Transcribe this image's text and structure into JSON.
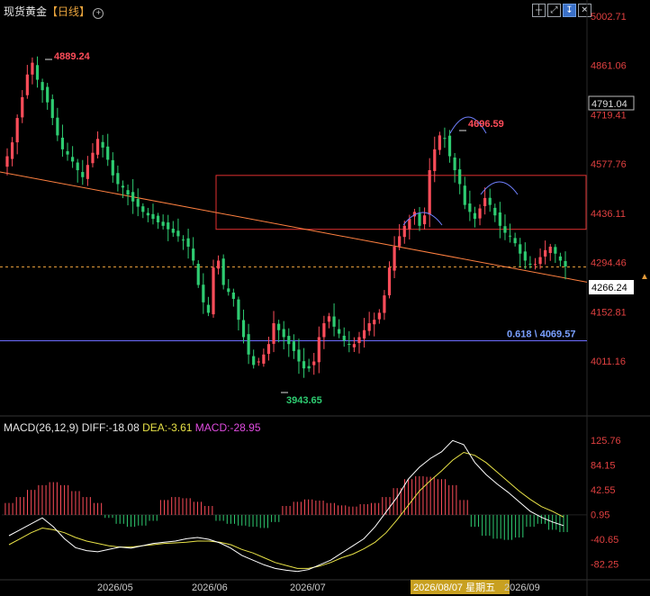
{
  "header": {
    "title": "现货黄金",
    "period": "【日线】",
    "toolbar_icons": [
      "crosshair-icon",
      "fullscreen-icon",
      "settings-icon",
      "close-icon"
    ]
  },
  "macd_header": {
    "label": "MACD(26,12,9)",
    "diff": "DIFF:-18.08",
    "dea": "DEA:-3.61",
    "macd": "MACD:-28.95"
  },
  "colors": {
    "up": "#ff4d5a",
    "down": "#2ecc71",
    "diff_line": "#ffffff",
    "dea_line": "#e8e247",
    "trendline": "#ff8040",
    "fib_line": "#6c6cff",
    "box": "#e03030",
    "arc": "#7080ff",
    "price_label_bg": "#ffffff"
  },
  "chart_data": [
    {
      "type": "candlestick",
      "title": "现货黄金 日线",
      "y_ticks": [
        "5002.71",
        "4861.06",
        "4791.04",
        "4719.41",
        "4577.76",
        "4436.11",
        "4294.46",
        "4266.24",
        "4152.81",
        "4011.16"
      ],
      "x_ticks": [
        "2026/05",
        "2026/06",
        "2026/07",
        "2026/08/07 星期五",
        "2026/09"
      ],
      "current_price": "4266.24",
      "last_visible_tick": "4791.04",
      "annotations": {
        "high_label": "4889.24",
        "low_label": "3943.65",
        "peak_label": "4696.59",
        "fib_label": "0.618 \\ 4069.57"
      },
      "fib_level": 4069.57,
      "resistance_box": [
        4390,
        4545
      ],
      "series": [
        {
          "name": "daily_close",
          "values": [
            4600,
            4640,
            4710,
            4770,
            4835,
            4869,
            4820,
            4790,
            4755,
            4710,
            4660,
            4620,
            4605,
            4585,
            4560,
            4540,
            4575,
            4610,
            4650,
            4625,
            4590,
            4545,
            4520,
            4510,
            4490,
            4470,
            4455,
            4440,
            4430,
            4420,
            4410,
            4400,
            4390,
            4380,
            4370,
            4360,
            4340,
            4300,
            4230,
            4180,
            4150,
            4280,
            4300,
            4230,
            4210,
            4190,
            4130,
            4080,
            4030,
            4000,
            4010,
            4030,
            4060,
            4120,
            4100,
            4080,
            4060,
            4040,
            4010,
            3990,
            3990,
            4010,
            4080,
            4120,
            4140,
            4110,
            4090,
            4070,
            4060,
            4060,
            4080,
            4100,
            4120,
            4130,
            4150,
            4200,
            4280,
            4340,
            4370,
            4400,
            4420,
            4440,
            4400,
            4430,
            4560,
            4620,
            4660,
            4650,
            4600,
            4560,
            4520,
            4460,
            4440,
            4420,
            4450,
            4480,
            4460,
            4430,
            4400,
            4380,
            4370,
            4350,
            4320,
            4300,
            4290,
            4290,
            4310,
            4330,
            4340,
            4320,
            4300,
            4283
          ]
        }
      ]
    },
    {
      "type": "bar",
      "title": "MACD(26,12,9)",
      "y_ticks": [
        "125.76",
        "84.15",
        "42.55",
        "0.95",
        "-40.65",
        "-82.25"
      ],
      "ylim": [
        -103,
        136
      ],
      "series": [
        {
          "name": "DIFF",
          "values": [
            -35,
            -25,
            -15,
            -5,
            -20,
            -40,
            -55,
            -60,
            -62,
            -58,
            -54,
            -56,
            -52,
            -48,
            -46,
            -44,
            -40,
            -38,
            -41,
            -47,
            -56,
            -68,
            -76,
            -84,
            -90,
            -93,
            -95,
            -92,
            -84,
            -76,
            -64,
            -52,
            -40,
            -20,
            5,
            30,
            60,
            80,
            95,
            106,
            125,
            118,
            88,
            68,
            52,
            38,
            22,
            6,
            -4,
            -12,
            -18
          ]
        },
        {
          "name": "DEA",
          "values": [
            -50,
            -40,
            -30,
            -22,
            -25,
            -30,
            -38,
            -44,
            -48,
            -52,
            -54,
            -54,
            -52,
            -50,
            -48,
            -47,
            -46,
            -44,
            -44,
            -46,
            -50,
            -58,
            -64,
            -72,
            -80,
            -85,
            -90,
            -90,
            -86,
            -80,
            -72,
            -66,
            -57,
            -46,
            -30,
            -8,
            16,
            40,
            58,
            74,
            92,
            105,
            100,
            88,
            72,
            56,
            40,
            26,
            14,
            6,
            -3.61
          ]
        },
        {
          "name": "MACD",
          "values": [
            20,
            30,
            42,
            50,
            55,
            50,
            40,
            30,
            20,
            -5,
            -15,
            -20,
            -18,
            -10,
            25,
            30,
            28,
            22,
            15,
            -10,
            -15,
            -18,
            -20,
            -22,
            -12,
            15,
            22,
            26,
            24,
            20,
            16,
            14,
            18,
            20,
            30,
            45,
            60,
            65,
            64,
            60,
            50,
            25,
            -20,
            -35,
            -40,
            -42,
            -38,
            -20,
            -15,
            -25,
            -28.95
          ]
        }
      ]
    }
  ]
}
